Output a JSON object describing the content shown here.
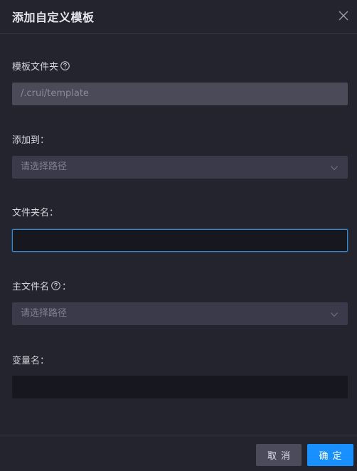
{
  "dialog": {
    "title": "添加自定义模板"
  },
  "form": {
    "template_folder": {
      "label": "模板文件夹",
      "value": "/.crui/template"
    },
    "add_to": {
      "label": "添加到：",
      "placeholder": "请选择路径"
    },
    "folder_name": {
      "label": "文件夹名：",
      "value": ""
    },
    "main_file_name": {
      "label": "主文件名",
      "label_suffix": "：",
      "placeholder": "请选择路径"
    },
    "variable_name": {
      "label": "变量名：",
      "value": ""
    }
  },
  "footer": {
    "cancel_label": "取消",
    "ok_label": "确定"
  },
  "colors": {
    "background": "#24242f",
    "primary": "#1890ff",
    "focus_border": "#2f8bd8"
  },
  "icons": {
    "close": "close-icon",
    "help": "question-circle-icon",
    "dropdown": "chevron-down-icon"
  }
}
